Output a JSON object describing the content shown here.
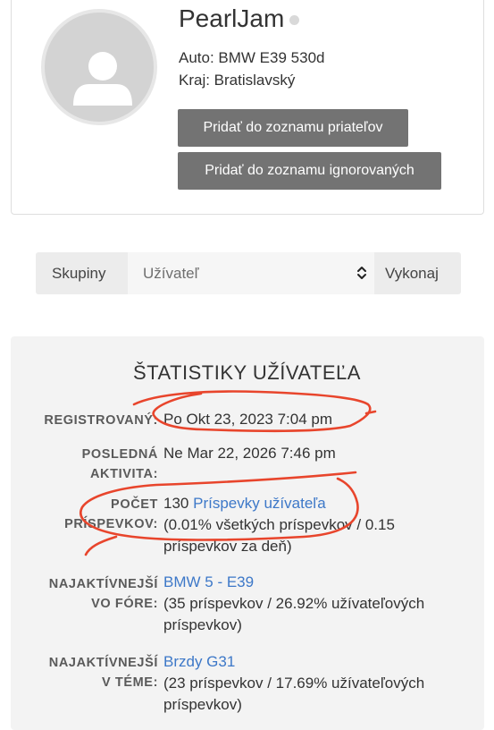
{
  "profile": {
    "username": "PearlJam",
    "car": "Auto: BMW E39 530d",
    "region": "Kraj: Bratislavský",
    "add_friend_label": "Pridať do zoznamu priateľov",
    "add_ignore_label": "Pridať do zoznamu ignorovaných"
  },
  "group_bar": {
    "label": "Skupiny",
    "selected": "Užívateľ",
    "submit": "Vykonaj"
  },
  "stats": {
    "title": "ŠTATISTIKY UŽÍVATEĽA",
    "registered": {
      "label": "REGISTROVANÝ:",
      "value": "Po Okt 23, 2023 7:04 pm"
    },
    "last_activity": {
      "label_line1": "POSLEDNÁ",
      "label_line2": "AKTIVITA:",
      "value": "Ne Mar 22, 2026 7:46 pm"
    },
    "post_count": {
      "label_line1": "POČET",
      "label_line2": "PRÍSPEVKOV:",
      "count": "130",
      "link": "Príspevky užívateľa",
      "detail_line1": "(0.01% všetkých príspevkov / 0.15",
      "detail_line2": "príspevkov za deň)"
    },
    "most_active_forum": {
      "label_line1": "NAJAKTÍVNEJŠÍ",
      "label_line2": "VO FÓRE:",
      "link": "BMW 5 - E39",
      "detail_line1": "(35 príspevkov / 26.92% užívateľových",
      "detail_line2": "príspevkov)"
    },
    "most_active_topic": {
      "label_line1": "NAJAKTÍVNEJŠÍ",
      "label_line2": "V TÉME:",
      "link": "Brzdy G31",
      "detail_line1": "(23 príspevkov / 17.69% užívateľových",
      "detail_line2": "príspevkov)"
    }
  },
  "colors": {
    "link": "#3d78c8",
    "button": "#737373",
    "annotation": "#e8452c"
  }
}
